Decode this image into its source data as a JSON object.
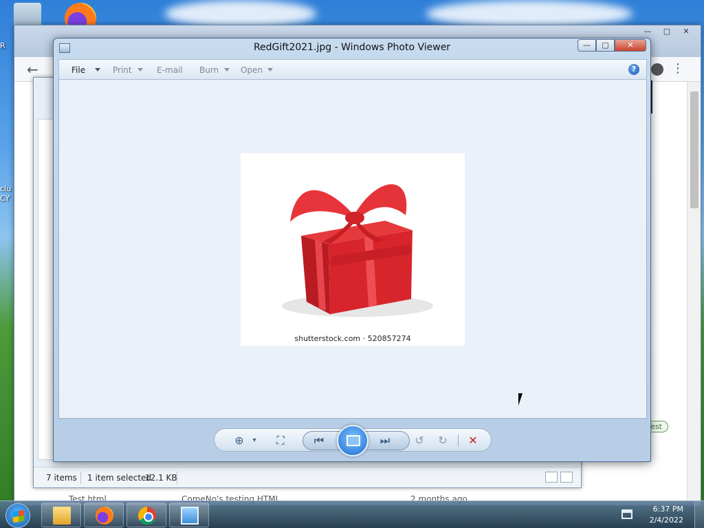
{
  "viewer": {
    "title": "RedGift2021.jpg - Windows Photo Viewer",
    "menu": {
      "file": "File",
      "print": "Print",
      "email": "E-mail",
      "burn": "Burn",
      "open": "Open"
    },
    "help": "?",
    "photo_caption": "shutterstock.com · 520857274"
  },
  "explorer": {
    "item_count": "7 items",
    "selection": "1 item selected",
    "size": "12.1 KB"
  },
  "background": {
    "row_name": "Test.html",
    "row_desc": "ComeNo's testing HTML",
    "row_date": "2 months ago",
    "tag": "Test",
    "desktop_label_1": "R",
    "desktop_label_2": "clu",
    "desktop_label_3": "CY"
  },
  "taskbar": {
    "time": "6:37 PM",
    "date": "2/4/2022"
  },
  "colors": {
    "accent_close": "#c9432c",
    "delete_red": "#c42020",
    "gift_red": "#d8242b"
  }
}
